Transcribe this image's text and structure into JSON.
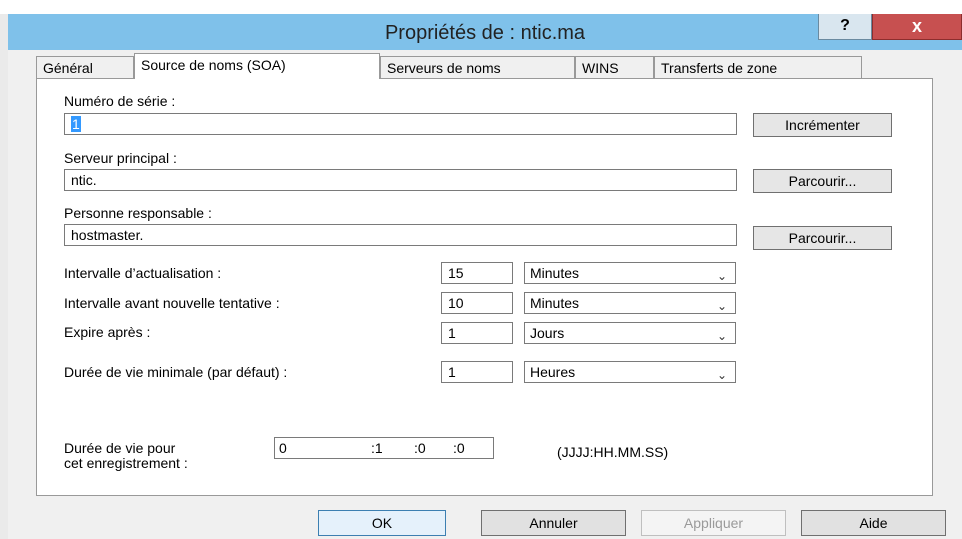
{
  "window": {
    "title": "Propriétés de : ntic.ma",
    "help_label": "?",
    "close_label": "x"
  },
  "tabs": [
    {
      "label": "Général"
    },
    {
      "label": "Source de noms (SOA)"
    },
    {
      "label": "Serveurs de noms"
    },
    {
      "label": "WINS"
    },
    {
      "label": "Transferts de zone"
    }
  ],
  "soa": {
    "serial_label": "Numéro de série :",
    "serial_value": "1",
    "increment_label": "Incrémenter",
    "primary_label": "Serveur principal :",
    "primary_value": "ntic.",
    "browse1_label": "Parcourir...",
    "responsible_label": "Personne responsable :",
    "responsible_value": "hostmaster.",
    "browse2_label": "Parcourir...",
    "intervals": [
      {
        "label": "Intervalle d’actualisation :",
        "value": "15",
        "unit": "Minutes"
      },
      {
        "label": "Intervalle avant nouvelle tentative :",
        "value": "10",
        "unit": "Minutes"
      },
      {
        "label": "Expire après :",
        "value": "1",
        "unit": "Jours"
      },
      {
        "label": "Durée de vie minimale (par défaut) :",
        "value": "1",
        "unit": "Heures"
      }
    ],
    "ttl_label_line1": "Durée de vie pour",
    "ttl_label_line2": "cet enregistrement :",
    "ttl_days": "0",
    "ttl_hours": ":1",
    "ttl_minutes": ":0",
    "ttl_seconds": ":0",
    "ttl_format": "(JJJJ:HH.MM.SS)"
  },
  "footer": {
    "ok_label": "OK",
    "cancel_label": "Annuler",
    "apply_label": "Appliquer",
    "help_label": "Aide"
  }
}
